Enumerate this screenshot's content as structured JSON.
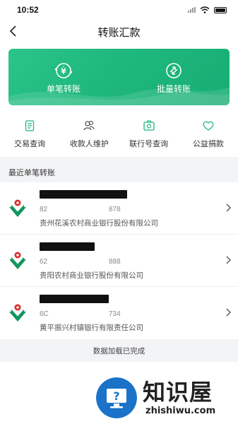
{
  "status_bar": {
    "time": "10:52"
  },
  "nav": {
    "title": "转账汇款"
  },
  "hero": {
    "single_label": "单笔转账",
    "batch_label": "批量转账",
    "accent_color": "#1fb87c"
  },
  "quick_actions": [
    {
      "label": "交易查询",
      "icon": "receipt-icon"
    },
    {
      "label": "收款人维护",
      "icon": "contacts-icon"
    },
    {
      "label": "联行号查询",
      "icon": "bank-code-icon"
    },
    {
      "label": "公益捐款",
      "icon": "heart-icon"
    }
  ],
  "recent": {
    "title": "最近单笔转账",
    "items": [
      {
        "account_prefix": "82",
        "account_suffix": "878",
        "bank": "贵州花溪农村商业银行股份有限公司",
        "name_redacted": true
      },
      {
        "account_prefix": "62",
        "account_suffix": "888",
        "bank": "贵阳农村商业银行股份有限公司",
        "name_redacted": true
      },
      {
        "account_prefix": "6C",
        "account_suffix": "734",
        "bank": "黄平振兴村镇银行有限责任公司",
        "name_redacted": true
      }
    ]
  },
  "footer": {
    "status": "数据加载已完成"
  },
  "watermark": {
    "brand": "知识屋",
    "domain": "zhishiwu.com"
  }
}
